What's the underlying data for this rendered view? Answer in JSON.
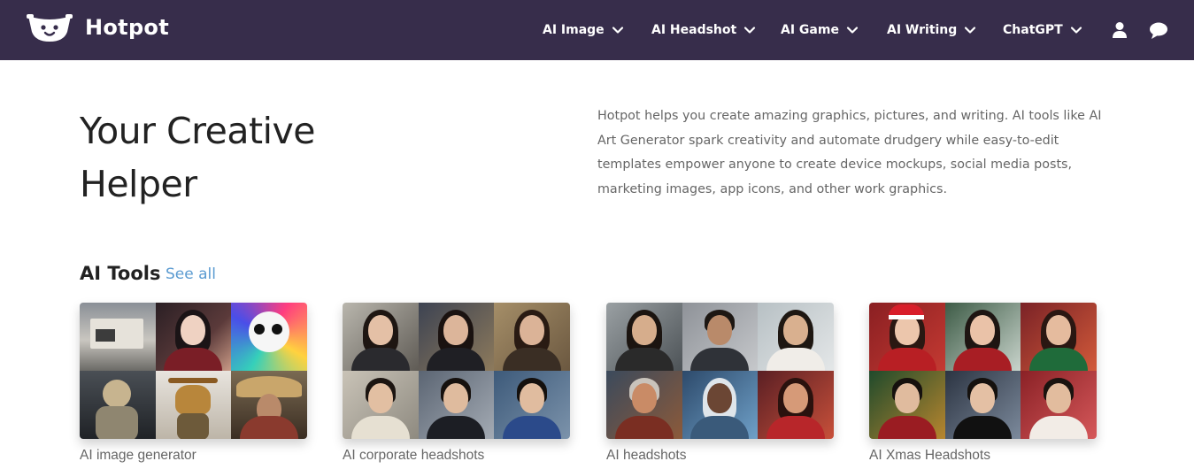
{
  "header": {
    "logo_text": "Hotpot",
    "nav": [
      {
        "label": "AI Image"
      },
      {
        "label": "AI Headshot"
      },
      {
        "label": "AI Game"
      },
      {
        "label": "AI Writing"
      },
      {
        "label": "ChatGPT"
      }
    ],
    "icons": [
      "user-icon",
      "chat-icon"
    ],
    "colors": {
      "background": "#372d4b",
      "text": "#ffffff"
    }
  },
  "hero": {
    "title_line1": "Your Creative",
    "title_line2": "Helper",
    "description": "Hotpot helps you create amazing graphics, pictures, and writing. AI tools like AI Art Generator spark creativity and automate drudgery while easy-to-edit templates empower anyone to create device mockups, social media posts, marketing images, app icons, and other work graphics."
  },
  "ai_tools": {
    "title": "AI Tools",
    "see_all": "See all",
    "see_all_color": "#5b9bd1",
    "cards": [
      {
        "label": "AI image generator"
      },
      {
        "label": "AI corporate headshots"
      },
      {
        "label": "AI headshots"
      },
      {
        "label": "AI Xmas Headshots"
      }
    ]
  }
}
